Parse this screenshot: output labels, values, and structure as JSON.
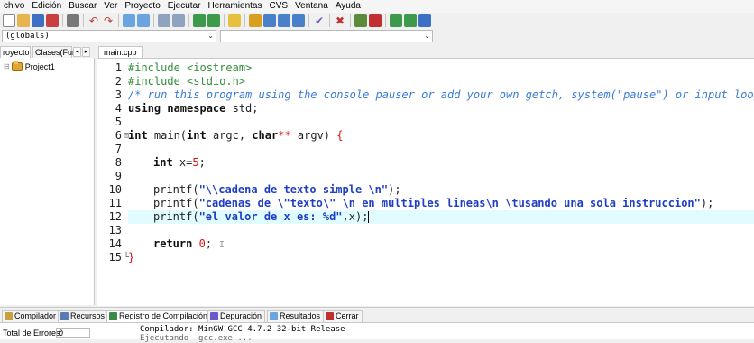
{
  "menu": [
    "chivo",
    "Edición",
    "Buscar",
    "Ver",
    "Proyecto",
    "Ejecutar",
    "Herramientas",
    "CVS",
    "Ventana",
    "Ayuda"
  ],
  "dropdowns": {
    "scope": "(globals)",
    "member": ""
  },
  "left_tabs": {
    "project": "royecto",
    "classes": "Clases(Fun",
    "scroll_left": "◂",
    "scroll_right": "▸"
  },
  "tree": {
    "project": "Project1"
  },
  "editor": {
    "tab": "main.cpp",
    "line_numbers": [
      "1",
      "2",
      "3",
      "4",
      "5",
      "6",
      "7",
      "8",
      "9",
      "10",
      "11",
      "12",
      "13",
      "14",
      "15"
    ],
    "fold_markers": [
      "",
      "",
      "",
      "",
      "",
      "⊟",
      "",
      "",
      "",
      "",
      "",
      "",
      "",
      "",
      "└"
    ]
  },
  "code": {
    "l1": "#include <iostream>",
    "l2": "#include <stdio.h>",
    "l3": "/* run this program using the console pauser or add your own getch, system(\"pause\") or input loop */",
    "l4_kw": "using namespace",
    "l4_rest": " std;",
    "l6_kw1": "int",
    "l6_a": " main(",
    "l6_kw2": "int",
    "l6_b": " argc, ",
    "l6_kw3": "char",
    "l6_stars": "**",
    "l6_c": " argv) ",
    "l6_brace": "{",
    "l8_kw": "int",
    "l8_a": " x=",
    "l8_num": "5",
    "l8_b": ";",
    "l10_a": "printf(",
    "l10_str": "\"\\\\cadena de texto simple \\n\"",
    "l10_b": ");",
    "l11_a": "printf(",
    "l11_str": "\"cadenas de \\\"texto\\\" \\n en multiples lineas\\n \\tusando una sola instruccion\"",
    "l11_b": ");",
    "l12_a": "printf(",
    "l12_str": "\"el valor de x es: %d\"",
    "l12_b": ",x);",
    "l14_kw": "return",
    "l14_num": " 0",
    "l14_b": ";",
    "l14_cursor": "I",
    "l15": "}"
  },
  "bottom_tabs": [
    "Compilador",
    "Recursos",
    "Registro de Compilación",
    "Depuración",
    "Resultados",
    "Cerrar"
  ],
  "bottom_panel": {
    "errors_label": "Total de Errores:",
    "errors_value": "0",
    "log_line1": "Compilador: MinGW GCC 4.7.2 32-bit Release",
    "log_line2": "Ejecutando  gcc.exe ..."
  },
  "colors": {
    "accent_line": "#e0fcff",
    "keyword": "#111111",
    "string": "#1f3fc2",
    "preprocessor": "#2f8e3a",
    "comment": "#3a7bd5",
    "number": "#dd1111"
  }
}
